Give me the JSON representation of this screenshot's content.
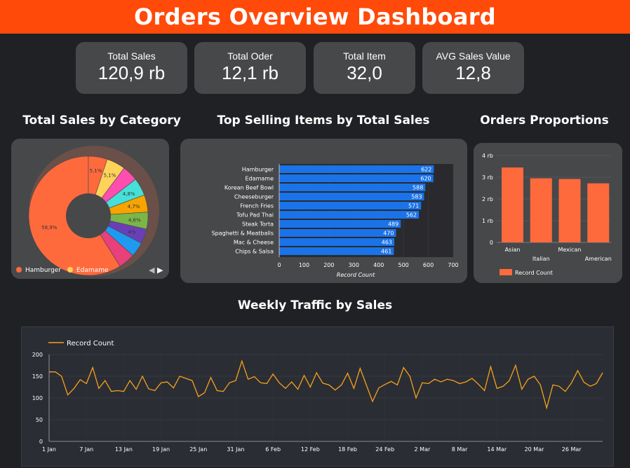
{
  "header": {
    "title": "Orders Overview  Dashboard"
  },
  "kpis": [
    {
      "label": "Total Sales",
      "value": "120,9 rb"
    },
    {
      "label": "Total Oder",
      "value": "12,1 rb"
    },
    {
      "label": "Total Item",
      "value": "32,0"
    },
    {
      "label": "AVG Sales Value",
      "value": "12,8"
    }
  ],
  "colors": {
    "accent": "#ff4a0a",
    "panel": "#47484a",
    "background": "#202124",
    "bar_blue": "#1a73e8",
    "bar_orange": "#ff6a3d",
    "line_orange": "#f4a21b"
  },
  "pie": {
    "title": "Total Sales by Category",
    "legend": [
      {
        "name": "Hamburger",
        "color": "#ff6a3d"
      },
      {
        "name": "Edamame",
        "color": "#ffd25a"
      }
    ],
    "nav_prev": "◀",
    "nav_next": "▶"
  },
  "barh": {
    "title": "Top Selling Items by Total Sales"
  },
  "orders": {
    "title": "Orders Proportions"
  },
  "weekly": {
    "title": "Weekly Traffic by Sales"
  },
  "chart_data": [
    {
      "type": "pie",
      "title": "Total Sales by Category",
      "donut": true,
      "slices": [
        {
          "name": "Hamburger",
          "value": 58.9,
          "label": "58,9%",
          "color": "#ff6a3d"
        },
        {
          "value": 4.5,
          "label": "",
          "color": "#e8407a"
        },
        {
          "value": 4.0,
          "label": "",
          "color": "#1e9bf0"
        },
        {
          "value": 4.0,
          "label": "4%",
          "color": "#6a3fb6"
        },
        {
          "value": 4.6,
          "label": "4,6%",
          "color": "#7ab648"
        },
        {
          "value": 4.7,
          "label": "4,7%",
          "color": "#f7a400"
        },
        {
          "value": 4.8,
          "label": "4,8%",
          "color": "#46e0d8"
        },
        {
          "value": 4.3,
          "label": "",
          "color": "#ff4db0"
        },
        {
          "name": "Edamame",
          "value": 5.1,
          "label": "5,1%",
          "color": "#ffd25a"
        },
        {
          "value": 5.1,
          "label": "5,1%",
          "color": "#ff6a3d"
        }
      ],
      "legend_position": "bottom"
    },
    {
      "type": "bar",
      "orientation": "horizontal",
      "title": "Top Selling Items by Total Sales",
      "categories": [
        "Hamburger",
        "Edamame",
        "Korean Beef Bowl",
        "Cheeseburger",
        "French Fries",
        "Tofu Pad Thai",
        "Steak Torta",
        "Spaghetti & Meatballs",
        "Mac & Cheese",
        "Chips & Salsa"
      ],
      "values": [
        622,
        620,
        588,
        583,
        571,
        562,
        489,
        470,
        463,
        461
      ],
      "value_labels": [
        "622",
        "620",
        "588",
        "583",
        "571",
        "562",
        "489",
        "470",
        "463",
        "461"
      ],
      "xlabel": "Record Count",
      "xlim": [
        0,
        700
      ],
      "xticks": [
        "0",
        "100",
        "200",
        "300",
        "400",
        "500",
        "600",
        "700"
      ],
      "grid": true
    },
    {
      "type": "bar",
      "title": "Orders Proportions",
      "categories": [
        "Asian",
        "Italian",
        "Mexican",
        "American"
      ],
      "values": [
        3.45,
        2.95,
        2.92,
        2.72
      ],
      "yticks": [
        "0",
        "1 rb",
        "2 rb",
        "3 rb",
        "4 rb"
      ],
      "ylim": [
        0,
        4
      ],
      "series": [
        {
          "name": "Record Count",
          "values": [
            3.45,
            2.95,
            2.92,
            2.72
          ]
        }
      ],
      "legend_position": "bottom-left"
    },
    {
      "type": "line",
      "title": "Weekly Traffic by Sales",
      "series": [
        {
          "name": "Record Count",
          "values": [
            160,
            160,
            150,
            107,
            122,
            142,
            133,
            170,
            122,
            140,
            115,
            117,
            115,
            140,
            120,
            150,
            121,
            117,
            135,
            137,
            123,
            150,
            145,
            140,
            103,
            112,
            147,
            117,
            115,
            135,
            140,
            185,
            143,
            149,
            135,
            133,
            155,
            135,
            122,
            137,
            120,
            152,
            125,
            158,
            134,
            130,
            118,
            130,
            157,
            122,
            168,
            130,
            92,
            123,
            131,
            138,
            130,
            170,
            150,
            100,
            135,
            133,
            143,
            137,
            143,
            140,
            133,
            137,
            145,
            132,
            117,
            172,
            122,
            127,
            140,
            175,
            120,
            143,
            150,
            130,
            77,
            130,
            127,
            115,
            135,
            163,
            136,
            127,
            133,
            158
          ]
        }
      ],
      "x_ticks": [
        "1 Jan",
        "7 Jan",
        "13 Jan",
        "19 Jan",
        "25 Jan",
        "31 Jan",
        "6 Feb",
        "12 Feb",
        "18 Feb",
        "24 Feb",
        "2 Mar",
        "8 Mar",
        "14 Mar",
        "20 Mar",
        "26 Mar"
      ],
      "y_ticks": [
        "0",
        "50",
        "100",
        "150",
        "200"
      ],
      "ylim": [
        0,
        200
      ],
      "grid": true,
      "legend_position": "top-left"
    }
  ]
}
